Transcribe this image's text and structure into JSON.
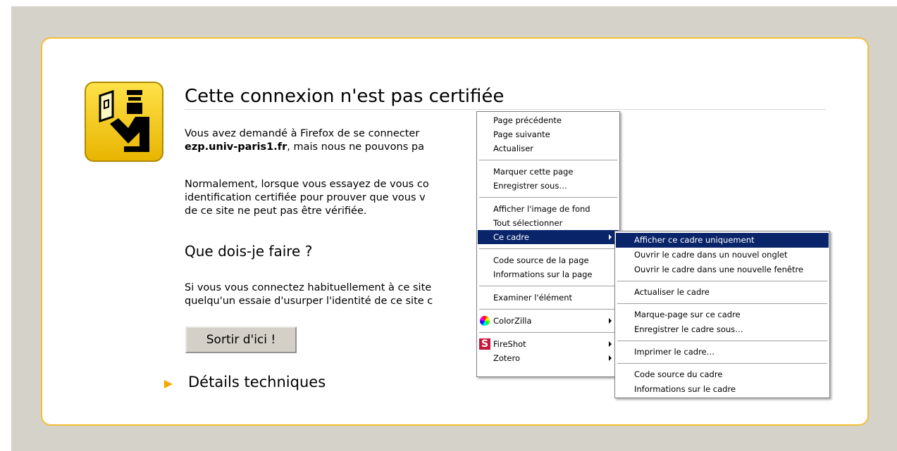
{
  "page": {
    "title": "Cette connexion n'est pas certifiée",
    "para1_line1": "Vous avez demandé à Firefox de se connecter",
    "para1_host": "ezp.univ-paris1.fr",
    "para1_line2_rest": ", mais nous ne pouvons pa",
    "para2_line1": "Normalement, lorsque vous essayez de vous co",
    "para2_line2": "identification certifiée pour prouver que vous v",
    "para2_line3": "de ce site ne peut pas être vérifiée.",
    "heading2": "Que dois-je faire ?",
    "para3_line1": "Si vous vous connectez habituellement à ce site",
    "para3_line2": "quelqu'un essaie d'usurper l'identité de ce site c",
    "escape_button": "Sortir d'ici !",
    "tech_details": "Détails techniques"
  },
  "context_menu": {
    "items": [
      "Page précédente",
      "Page suivante",
      "Actualiser",
      "Marquer cette page",
      "Enregistrer sous…",
      "Afficher l'image de fond",
      "Tout sélectionner",
      "Ce cadre",
      "Code source de la page",
      "Informations sur la page",
      "Examiner l'élément",
      "ColorZilla",
      "FireShot",
      "Zotero"
    ]
  },
  "submenu": {
    "items": [
      "Afficher ce cadre uniquement",
      "Ouvrir le cadre dans un nouvel onglet",
      "Ouvrir le cadre dans une nouvelle fenêtre",
      "Actualiser le cadre",
      "Marque-page sur ce cadre",
      "Enregistrer le cadre sous…",
      "Imprimer le cadre…",
      "Code source du cadre",
      "Informations sur le cadre"
    ]
  },
  "colors": {
    "background": "#d5d2ca",
    "card_border": "#f5c034",
    "highlight": "#0a246a",
    "icon_yellow": "#f5c400"
  }
}
